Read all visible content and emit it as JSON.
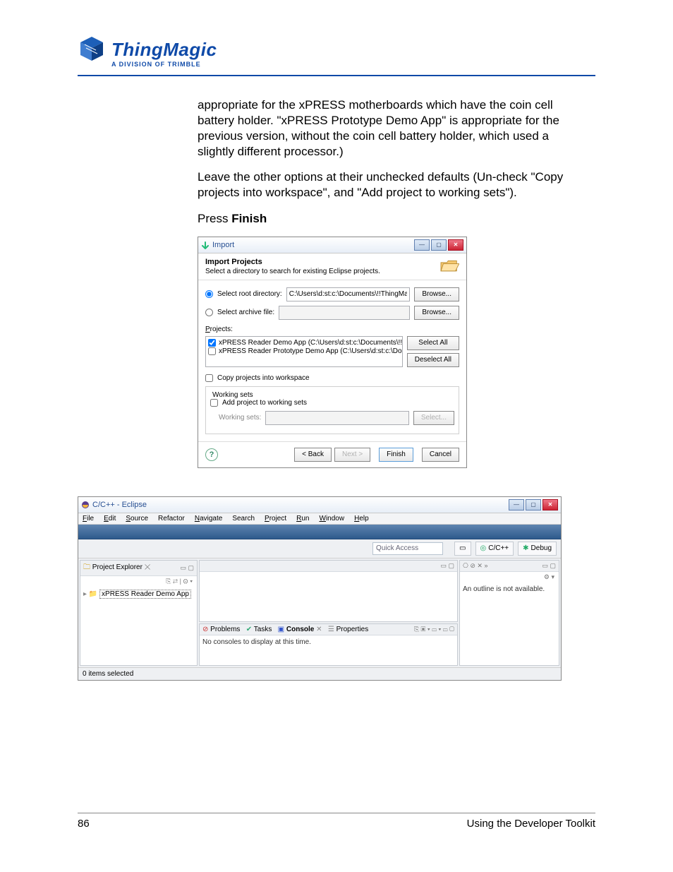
{
  "header": {
    "logo_text": "ThingMagic",
    "logo_sub": "A DIVISION OF TRIMBLE"
  },
  "body": {
    "para1": "appropriate for the xPRESS motherboards which have the coin cell battery holder. \"xPRESS Prototype Demo App\" is appropriate for the previous version, without the coin cell battery holder, which used a slightly different processor.)",
    "para2": "Leave the other options at their unchecked defaults (Un-check \"Copy projects into workspace\", and \"Add project to working sets\").",
    "para3_pre": "Press ",
    "para3_bold": "Finish"
  },
  "dialog": {
    "title": "Import",
    "header_title": "Import Projects",
    "header_desc": "Select a directory to search for existing Eclipse projects.",
    "root_label": "Select root directory:",
    "root_value": "C:\\Users\\d:st:c:\\Documents\\!!ThingMagic\\T",
    "browse": "Browse...",
    "archive_label": "Select archive file:",
    "projects_label": "Projects:",
    "project1": "xPRESS Reader Demo App (C:\\Users\\d:st:c:\\Documents\\!!Thing",
    "project2": "xPRESS Reader Prototype Demo App (C:\\Users\\d:st:c:\\Documen",
    "select_all": "Select All",
    "deselect_all": "Deselect All",
    "copy_label": "Copy projects into workspace",
    "working_sets_group": "Working sets",
    "add_ws_label": "Add project to working sets",
    "ws_label": "Working sets:",
    "select_btn": "Select...",
    "back": "< Back",
    "next": "Next >",
    "finish": "Finish",
    "cancel": "Cancel"
  },
  "ide": {
    "title": "C/C++ - Eclipse",
    "menu": [
      "File",
      "Edit",
      "Source",
      "Refactor",
      "Navigate",
      "Search",
      "Project",
      "Run",
      "Window",
      "Help"
    ],
    "quick_access": "Quick Access",
    "persp_ccpp": "C/C++",
    "persp_debug": "Debug",
    "project_explorer": "Project Explorer",
    "explorer_item": "xPRESS Reader Demo App",
    "outline_msg": "An outline is not available.",
    "tabs": [
      "Problems",
      "Tasks",
      "Console",
      "Properties"
    ],
    "console_msg": "No consoles to display at this time.",
    "status": "0 items selected"
  },
  "footer": {
    "page_no": "86",
    "label": "Using the Developer Toolkit"
  }
}
